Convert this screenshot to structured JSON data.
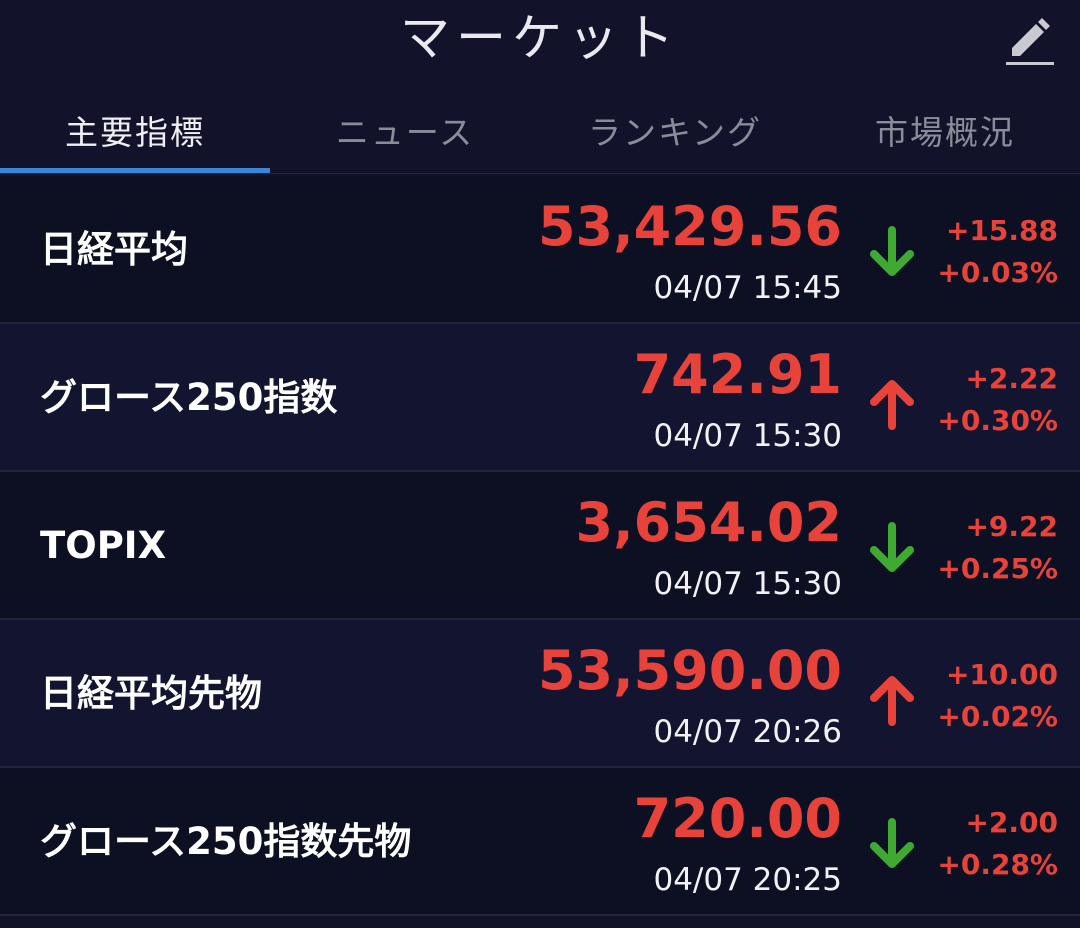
{
  "header": {
    "title": "マーケット",
    "edit_icon": "pencil-icon"
  },
  "tabs": [
    {
      "label": "主要指標",
      "active": true
    },
    {
      "label": "ニュース",
      "active": false
    },
    {
      "label": "ランキング",
      "active": false
    },
    {
      "label": "市場概況",
      "active": false
    }
  ],
  "colors": {
    "background": "#12132a",
    "accent": "#3b86d9",
    "price_red": "#e8433a",
    "arrow_up": "#e8433a",
    "arrow_down": "#3faa32"
  },
  "indices": [
    {
      "name": "日経平均",
      "price": "53,429.56",
      "time": "04/07 15:45",
      "direction": "down",
      "change": "+15.88",
      "change_pct": "+0.03%"
    },
    {
      "name": "グロース250指数",
      "price": "742.91",
      "time": "04/07 15:30",
      "direction": "up",
      "change": "+2.22",
      "change_pct": "+0.30%"
    },
    {
      "name": "TOPIX",
      "price": "3,654.02",
      "time": "04/07 15:30",
      "direction": "down",
      "change": "+9.22",
      "change_pct": "+0.25%"
    },
    {
      "name": "日経平均先物",
      "price": "53,590.00",
      "time": "04/07 20:26",
      "direction": "up",
      "change": "+10.00",
      "change_pct": "+0.02%"
    },
    {
      "name": "グロース250指数先物",
      "price": "720.00",
      "time": "04/07 20:25",
      "direction": "down",
      "change": "+2.00",
      "change_pct": "+0.28%"
    }
  ]
}
